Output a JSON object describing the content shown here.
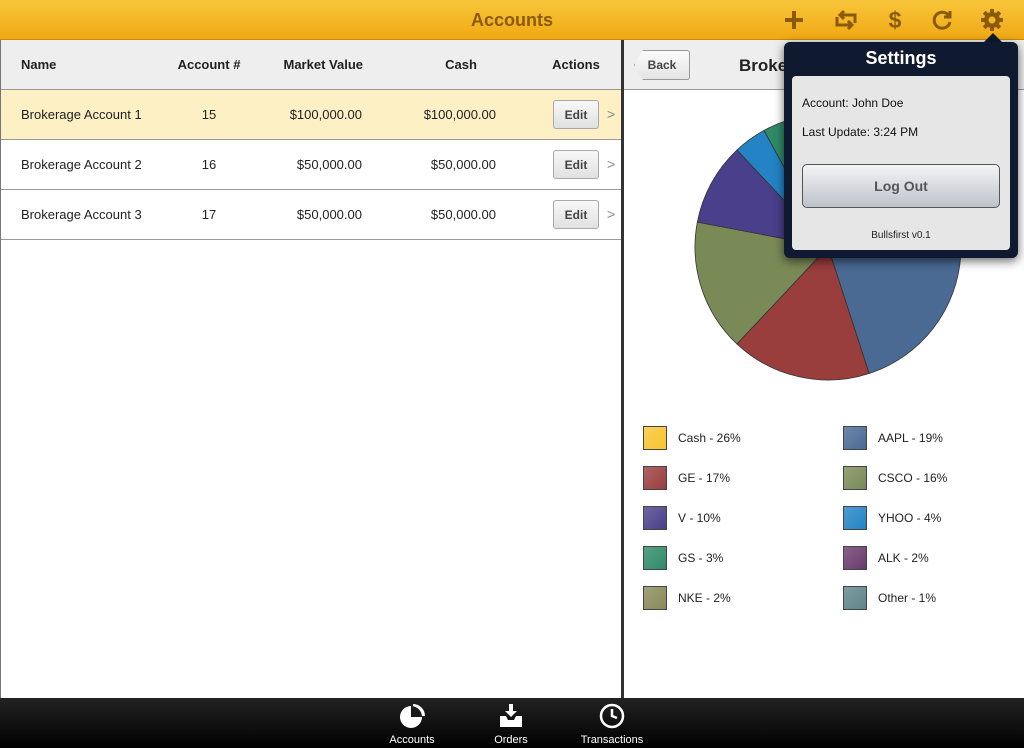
{
  "topbar": {
    "title": "Accounts",
    "icons": [
      "plus-icon",
      "transfer-icon",
      "dollar-icon",
      "refresh-icon",
      "gear-icon"
    ]
  },
  "accounts_table": {
    "headers": {
      "name": "Name",
      "number": "Account #",
      "market_value": "Market Value",
      "cash": "Cash",
      "actions": "Actions"
    },
    "rows": [
      {
        "name": "Brokerage Account 1",
        "number": "15",
        "market_value": "$100,000.00",
        "cash": "$100,000.00",
        "action": "Edit",
        "selected": true
      },
      {
        "name": "Brokerage Account 2",
        "number": "16",
        "market_value": "$50,000.00",
        "cash": "$50,000.00",
        "action": "Edit",
        "selected": false
      },
      {
        "name": "Brokerage Account 3",
        "number": "17",
        "market_value": "$50,000.00",
        "cash": "$50,000.00",
        "action": "Edit",
        "selected": false
      }
    ],
    "row_chevron": ">"
  },
  "detail": {
    "back_label": "Back",
    "title": "Brokerage Account 1"
  },
  "chart_data": {
    "type": "pie",
    "slices": [
      {
        "label": "Cash - 26%",
        "value": 26,
        "color": "#f7c52f"
      },
      {
        "label": "AAPL - 19%",
        "value": 19,
        "color": "#4a6a94"
      },
      {
        "label": "GE - 17%",
        "value": 17,
        "color": "#9a3d3d"
      },
      {
        "label": "CSCO - 16%",
        "value": 16,
        "color": "#7a8a57"
      },
      {
        "label": "V - 10%",
        "value": 10,
        "color": "#4a3f8a"
      },
      {
        "label": "YHOO - 4%",
        "value": 4,
        "color": "#2383c5"
      },
      {
        "label": "GS - 3%",
        "value": 3,
        "color": "#2f8a68"
      },
      {
        "label": "ALK - 2%",
        "value": 2,
        "color": "#6a3a6a"
      },
      {
        "label": "NKE - 2%",
        "value": 2,
        "color": "#8a8a5a"
      },
      {
        "label": "Other - 1%",
        "value": 1,
        "color": "#5f8588"
      }
    ],
    "legend_layout": "two columns below chart"
  },
  "settings_popover": {
    "title": "Settings",
    "account_line": "Account: John Doe",
    "update_line": "Last Update: 3:24 PM",
    "logout_label": "Log Out",
    "version": "Bullsfirst v0.1"
  },
  "tabbar": {
    "tabs": [
      {
        "label": "Accounts",
        "icon": "pie-chart-icon"
      },
      {
        "label": "Orders",
        "icon": "inbox-download-icon"
      },
      {
        "label": "Transactions",
        "icon": "clock-icon"
      }
    ]
  },
  "colors": {
    "accent": "#f0a914",
    "selected_row": "#fdf0c4",
    "popover": "#0f1a30"
  }
}
